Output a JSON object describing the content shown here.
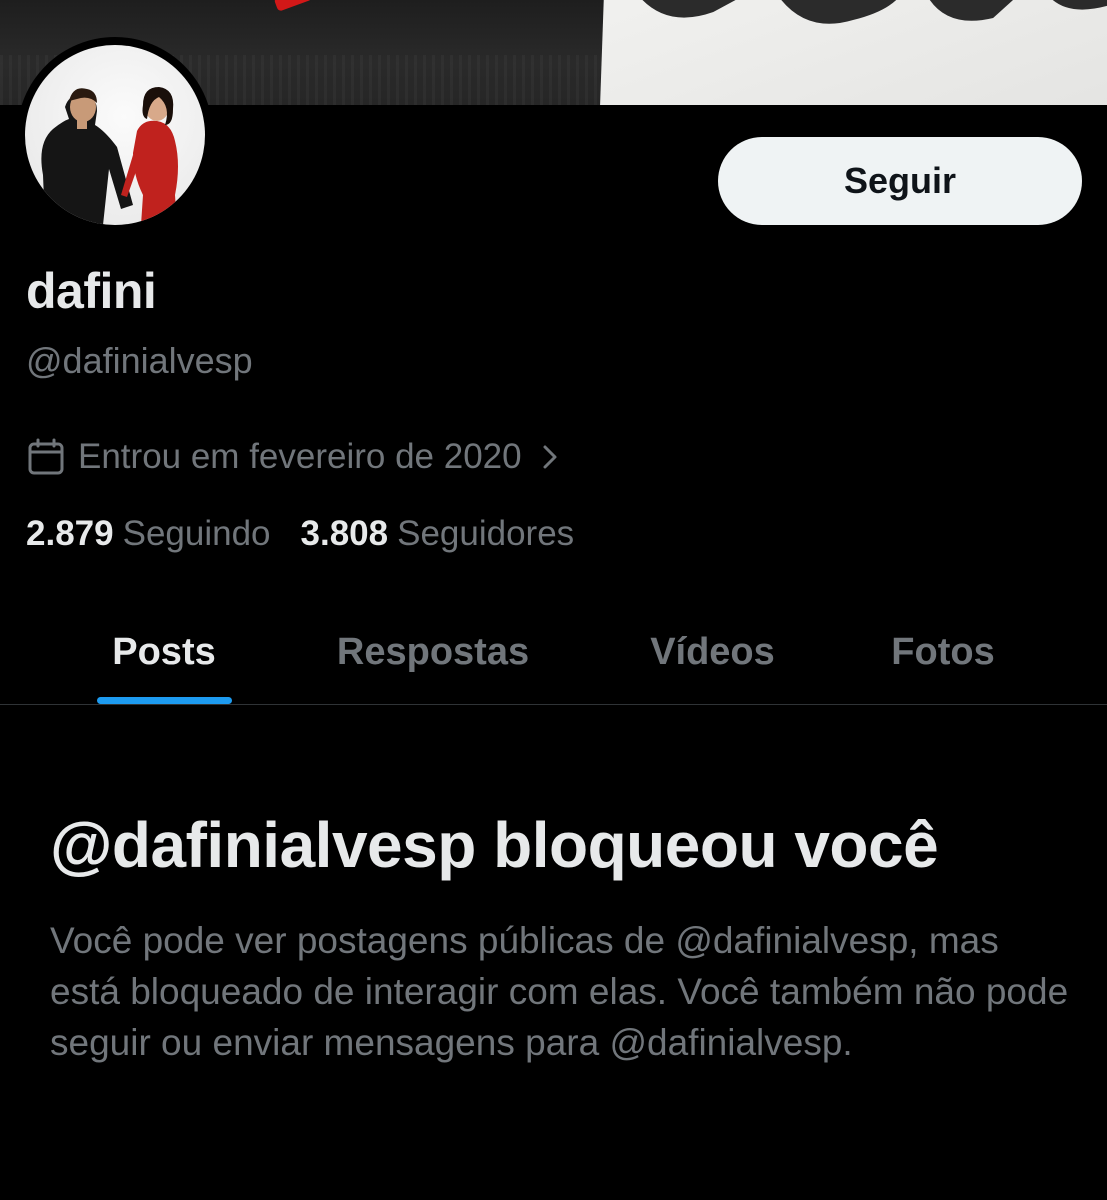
{
  "profile": {
    "display_name": "dafini",
    "handle": "@dafinialvesp",
    "joined": "Entrou em fevereiro de 2020",
    "following_count": "2.879",
    "following_label": "Seguindo",
    "followers_count": "3.808",
    "followers_label": "Seguidores"
  },
  "actions": {
    "follow_label": "Seguir"
  },
  "tabs": [
    {
      "label": "Posts",
      "active": true
    },
    {
      "label": "Respostas",
      "active": false
    },
    {
      "label": "Vídeos",
      "active": false
    },
    {
      "label": "Fotos",
      "active": false
    }
  ],
  "blocked_notice": {
    "title": "@dafinialvesp bloqueou você",
    "body": "Você pode ver postagens públicas de @dafinialvesp, mas está bloqueado de interagir com elas. Você também não pode seguir ou enviar mensagens para @dafinialvesp."
  },
  "colors": {
    "background": "#000000",
    "text_primary": "#e7e9ea",
    "text_secondary": "#71767b",
    "accent": "#1d9bf0",
    "button_bg": "#eff3f4",
    "divider": "#2f3336"
  },
  "icons": {
    "joined": "calendar-icon",
    "joined_more": "chevron-right-icon"
  }
}
